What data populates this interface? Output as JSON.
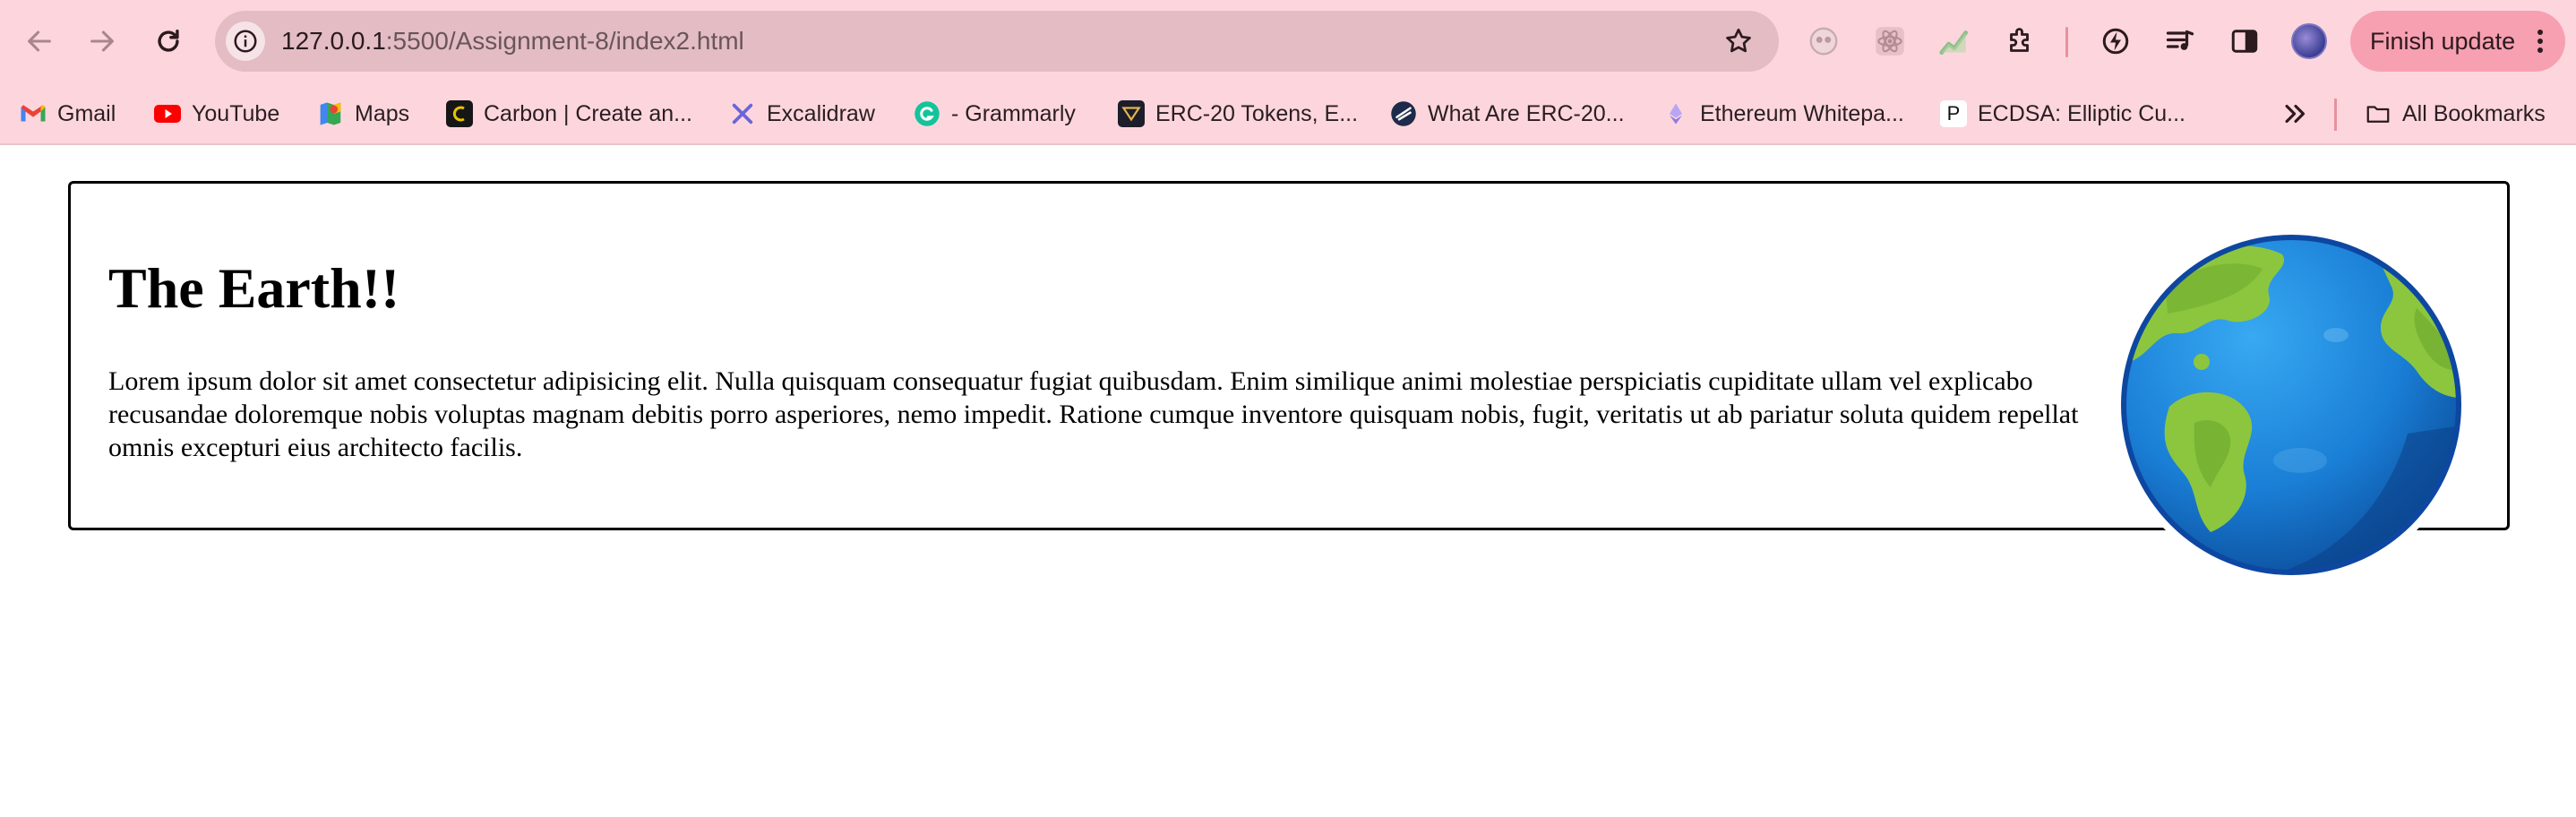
{
  "browser": {
    "url_host": "127.0.0.1",
    "url_path": ":5500/Assignment-8/index2.html",
    "finish_update_label": "Finish update"
  },
  "bookmarks": [
    {
      "label": "Gmail",
      "icon": "gmail-icon"
    },
    {
      "label": "YouTube",
      "icon": "youtube-icon"
    },
    {
      "label": "Maps",
      "icon": "maps-icon"
    },
    {
      "label": "Carbon | Create an...",
      "icon": "carbon-icon"
    },
    {
      "label": "Excalidraw",
      "icon": "excalidraw-icon"
    },
    {
      "label": "- Grammarly",
      "icon": "grammarly-icon"
    },
    {
      "label": "ERC-20 Tokens, E...",
      "icon": "erc20-icon"
    },
    {
      "label": "What Are ERC-20...",
      "icon": "zerion-icon"
    },
    {
      "label": "Ethereum Whitepa...",
      "icon": "ethereum-icon"
    },
    {
      "label": "ECDSA: Elliptic Cu...",
      "icon": "p-icon"
    }
  ],
  "all_bookmarks_label": "All Bookmarks",
  "page": {
    "title": "The Earth!!",
    "body": "Lorem ipsum dolor sit amet consectetur adipisicing elit. Nulla quisquam consequatur fugiat quibusdam. Enim similique animi molestiae perspiciatis cupiditate ullam vel explicabo recusandae doloremque nobis voluptas magnam debitis porro asperiores, nemo impedit. Ratione cumque inventore quisquam nobis, fugit, veritatis ut ab pariatur soluta quidem repellat omnis excepturi eius architecto facilis."
  },
  "colors": {
    "chrome_bg": "#fdd6dd",
    "omnibox_bg": "#e3bcc4",
    "finish_button_bg": "#f7a0b1",
    "ocean": "#1a7fd6",
    "land": "#8cc63f"
  }
}
